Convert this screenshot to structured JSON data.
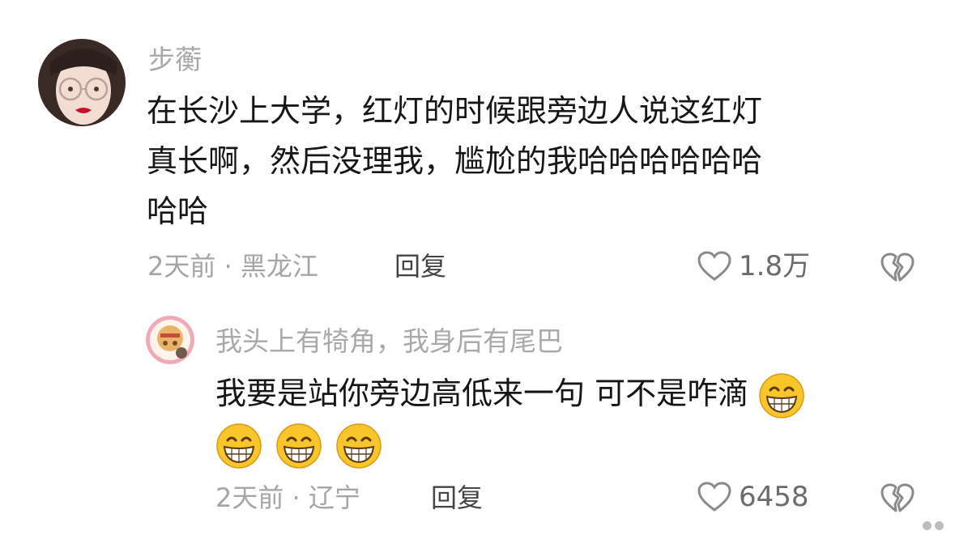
{
  "comments": [
    {
      "author": "步蘅",
      "lines": [
        "在长沙上大学，红灯的时候跟旁边人说这红灯",
        "真长啊，然后没理我，尴尬的我哈哈哈哈哈哈",
        "哈哈"
      ],
      "meta": "2天前 · 黑龙江",
      "reply_label": "回复",
      "likes": "1.8万"
    },
    {
      "author": "我头上有犄角，我身后有尾巴",
      "line1": "我要是站你旁边高低来一句 可不是咋滴",
      "emoji_count": 4,
      "emoji_icon": "grinning-face-icon",
      "meta": "2天前 · 辽宁",
      "reply_label": "回复",
      "likes": "6458"
    }
  ],
  "icons": {
    "like": "heart-outline-icon",
    "dislike": "broken-heart-icon"
  },
  "colors": {
    "text": "#161616",
    "muted": "#a9a9a9",
    "emoji_yellow": "#f8c52a"
  }
}
